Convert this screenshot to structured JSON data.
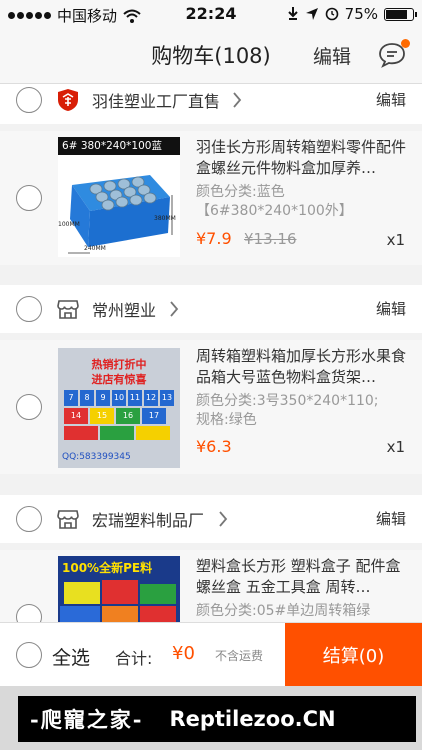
{
  "status_bar": {
    "carrier": "中国移动",
    "time": "22:24",
    "battery": "75%",
    "battery_level": 0.75
  },
  "nav": {
    "title": "购物车(108)",
    "edit": "编辑",
    "message_icon": "message-icon"
  },
  "shops": [
    {
      "name": "羽佳塑业工厂直售",
      "edit": "编辑",
      "item": {
        "title": "羽佳长方形周转箱塑料零件配件盒螺丝元件物料盒加厚养…",
        "spec1": "颜色分类:蓝色",
        "spec2": "【6#380*240*100外】",
        "price": "¥7.9",
        "old_price": "¥13.16",
        "qty": "x1",
        "thumb_label": "6# 380*240*100蓝",
        "dims": [
          "380MM",
          "100MM",
          "240MM"
        ]
      }
    },
    {
      "name": "常州塑业",
      "edit": "编辑",
      "item": {
        "title": "周转箱塑料箱加厚长方形水果食品箱大号蓝色物料盒货架…",
        "spec1": "颜色分类:3号350*240*110;",
        "spec2": "规格:绿色",
        "price": "¥6.3",
        "qty": "x1",
        "thumb_lines": [
          "热销打折中",
          "进店有惊喜"
        ],
        "box_numbers": [
          "7",
          "8",
          "9",
          "10",
          "11",
          "12",
          "13",
          "14",
          "15",
          "16",
          "17"
        ],
        "thumb_phone": "QQ:583399345"
      }
    },
    {
      "name": "宏瑞塑料制品厂",
      "edit": "编辑",
      "item": {
        "title": "塑料盒长方形 塑料盒子 配件盒 螺丝盒 五金工具盒 周转…",
        "spec1": "颜色分类:05#单边周转箱绿",
        "thumb_label": "100%全新PE料"
      }
    }
  ],
  "bottom": {
    "select_all": "全选",
    "total_label": "合计:",
    "total_value": "¥0",
    "shipping_note": "不含运费",
    "checkout": "结算(0)"
  },
  "watermark": {
    "cn": "-爬寵之家-",
    "en": "Reptilezoo.CN"
  },
  "colors": {
    "accent": "#ff5000",
    "price": "#ff5000",
    "background": "#f2f2f2"
  }
}
